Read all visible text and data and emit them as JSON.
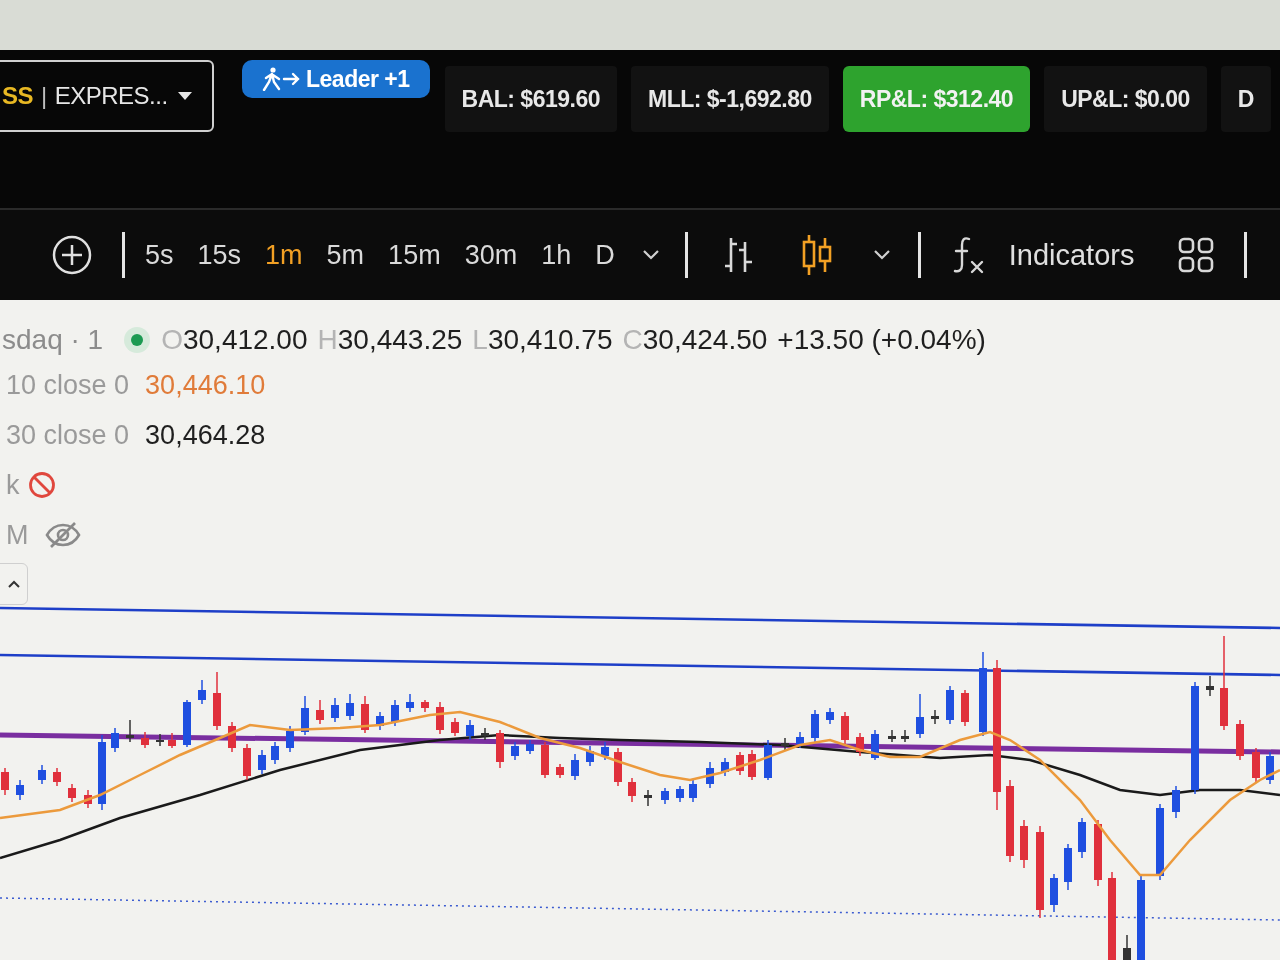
{
  "header": {
    "account_selector": {
      "prefix": "SS",
      "separator": "|",
      "label": "EXPRES..."
    },
    "leader_button": {
      "label": "Leader +1"
    },
    "stats": [
      {
        "label": "BAL: $619.60",
        "highlighted": false
      },
      {
        "label": "MLL: $-1,692.80",
        "highlighted": false
      },
      {
        "label": "RP&L: $312.40",
        "highlighted": true
      },
      {
        "label": "UP&L: $0.00",
        "highlighted": false
      },
      {
        "label": "D",
        "highlighted": false
      }
    ]
  },
  "toolbar": {
    "intervals": [
      {
        "label": "5s",
        "selected": false
      },
      {
        "label": "15s",
        "selected": false
      },
      {
        "label": "1m",
        "selected": true
      },
      {
        "label": "5m",
        "selected": false
      },
      {
        "label": "15m",
        "selected": false
      },
      {
        "label": "30m",
        "selected": false
      },
      {
        "label": "1h",
        "selected": false
      },
      {
        "label": "D",
        "selected": false
      }
    ],
    "indicators_button": {
      "label": "Indicators"
    }
  },
  "legend": {
    "symbol": "sdaq · 1",
    "ohlc": [
      {
        "label": "O",
        "value": "30,412.00"
      },
      {
        "label": "H",
        "value": "30,443.25"
      },
      {
        "label": "L",
        "value": "30,410.75"
      },
      {
        "label": "C",
        "value": "30,424.50"
      }
    ],
    "change": "+13.50 (+0.04%)",
    "studies": [
      {
        "kind": "value",
        "name": "10 close 0",
        "value": "30,446.10",
        "color": "#e07b39"
      },
      {
        "kind": "value",
        "name": "30 close 0",
        "value": "30,464.28",
        "color": "#1f1f1f"
      },
      {
        "kind": "error",
        "name": "k"
      },
      {
        "kind": "hidden",
        "name": "M"
      }
    ]
  }
}
